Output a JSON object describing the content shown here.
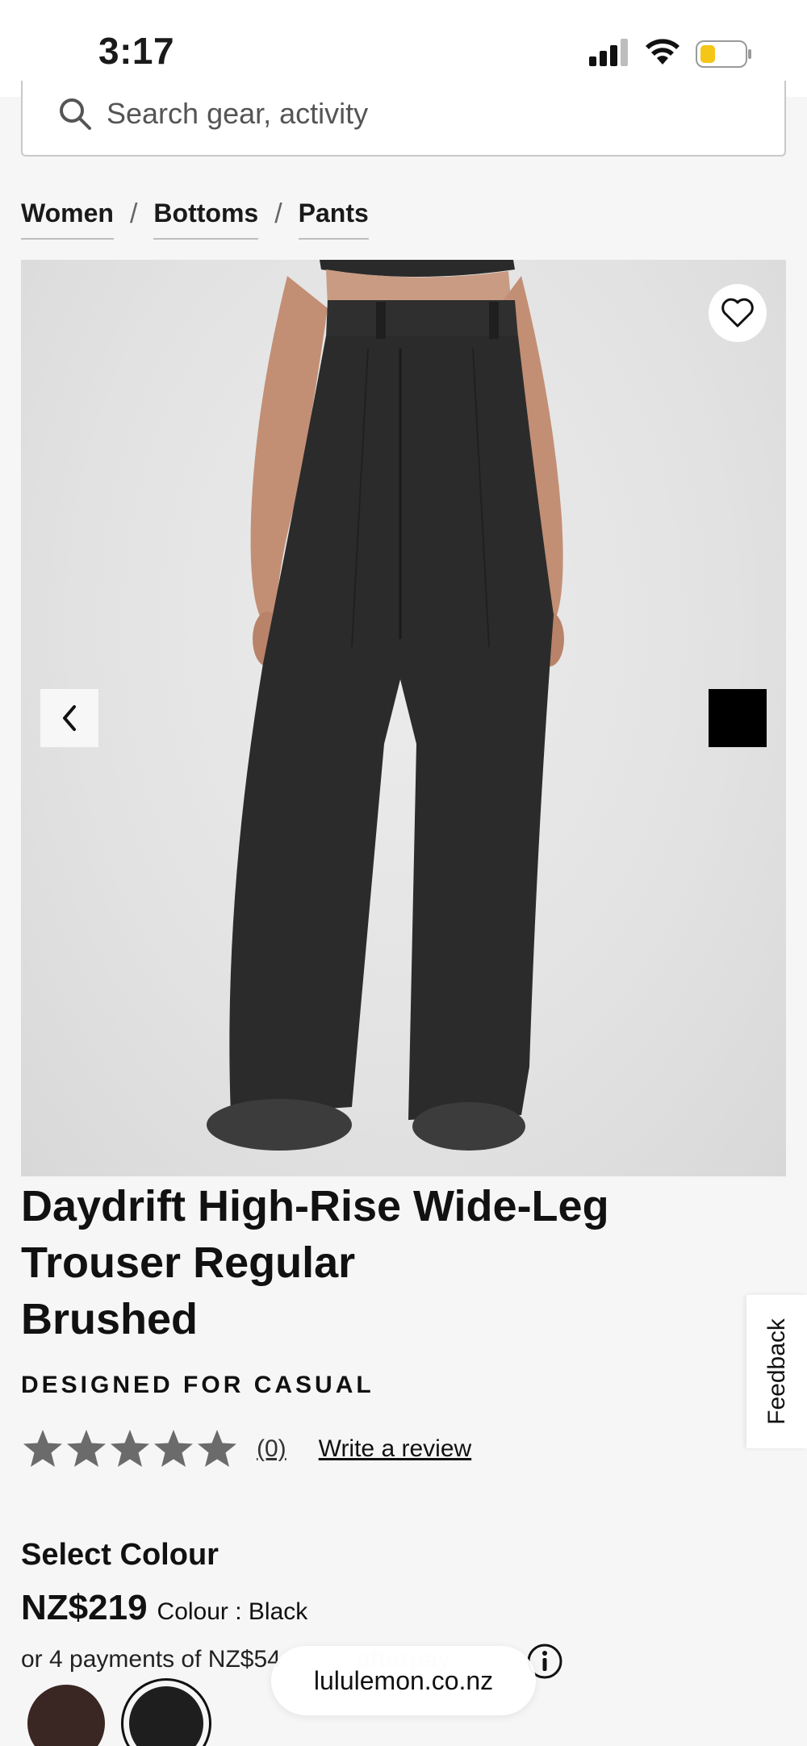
{
  "status_bar": {
    "time": "3:17"
  },
  "search": {
    "placeholder": "Search gear, activity"
  },
  "breadcrumb": {
    "items": [
      "Women",
      "Bottoms",
      "Pants"
    ],
    "separator": "/"
  },
  "product": {
    "title_lines": [
      "Daydrift High-Rise Wide-Leg",
      "Trouser Regular",
      "Brushed"
    ],
    "designed_for": "DESIGNED FOR CASUAL",
    "rating": {
      "stars": 5,
      "filled": 0,
      "review_count": "(0)",
      "write_review": "Write a review"
    },
    "select_colour": "Select Colour",
    "price": "NZ$219",
    "colour_label": "Colour : Black",
    "installments": "or 4 payments of NZ$54",
    "afterpay_logo": "afterpay",
    "swatches": [
      {
        "name": "brown",
        "color": "#3a2622"
      },
      {
        "name": "black",
        "color": "#1e1e1e",
        "selected": true
      }
    ]
  },
  "feedback": {
    "label": "Feedback"
  },
  "browser": {
    "url": "lululemon.co.nz"
  },
  "colors": {
    "background": "#f6f6f6",
    "star": "#6b6b6b",
    "battery_fill": "#f5c518"
  }
}
